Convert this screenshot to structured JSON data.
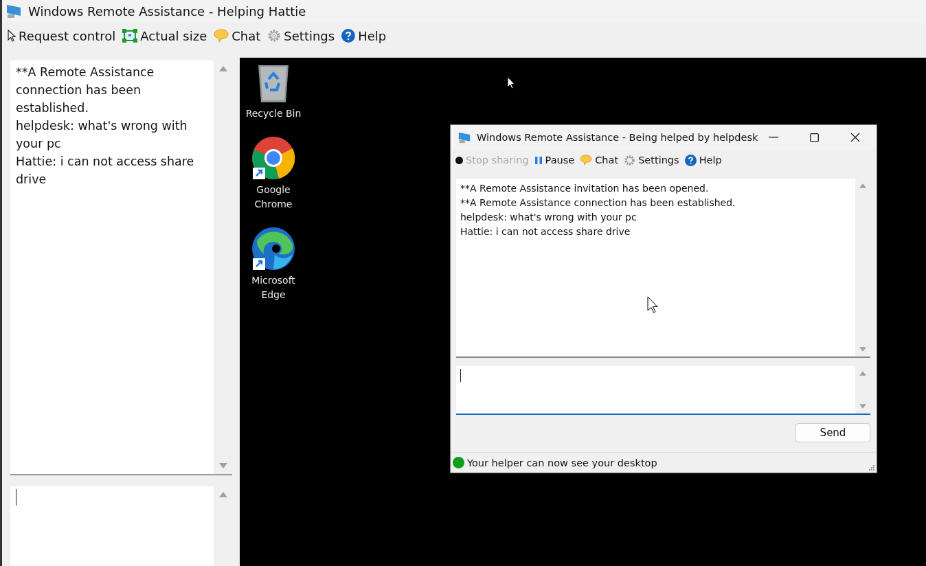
{
  "window": {
    "title": "Windows Remote Assistance - Helping Hattie"
  },
  "toolbar": [
    {
      "kind": "pointer",
      "label": "Request control"
    },
    {
      "kind": "resize",
      "label": "Actual size"
    },
    {
      "kind": "chat",
      "label": "Chat"
    },
    {
      "kind": "gear",
      "label": "Settings"
    },
    {
      "kind": "help",
      "label": "Help"
    }
  ],
  "chat_log": [
    "**A Remote Assistance connection has been established.",
    "helpdesk: what's wrong with your pc",
    "Hattie: i can not access share drive"
  ],
  "desktop_icons": [
    {
      "kind": "recycle",
      "label": "Recycle Bin"
    },
    {
      "kind": "chrome",
      "label": "Google Chrome"
    },
    {
      "kind": "edge",
      "label": "Microsoft Edge"
    }
  ],
  "remote_window": {
    "title": "Windows Remote Assistance - Being helped by helpdesk",
    "toolbar": [
      {
        "kind": "record",
        "label": "Stop sharing",
        "disabled": true
      },
      {
        "kind": "pause",
        "label": "Pause",
        "disabled": false
      },
      {
        "kind": "chat",
        "label": "Chat",
        "disabled": false
      },
      {
        "kind": "gear",
        "label": "Settings",
        "disabled": false
      },
      {
        "kind": "help",
        "label": "Help",
        "disabled": false
      }
    ],
    "chat_log": [
      "**A Remote Assistance invitation has been opened.",
      "**A Remote Assistance connection has been established.",
      "helpdesk: what's wrong with your pc",
      "Hattie: i can not access share drive"
    ],
    "send_button": "Send",
    "status": {
      "text": "Your helper can now see your desktop",
      "color": "#0f9d1a"
    }
  }
}
